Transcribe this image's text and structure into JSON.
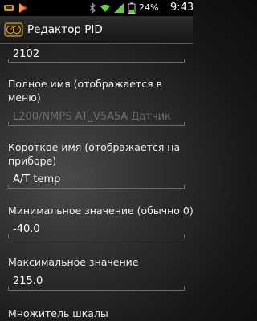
{
  "status_bar": {
    "battery_percent": "24%",
    "time": "9:43",
    "icons": [
      "notification-app-icon",
      "play-store-icon",
      "bluetooth-icon",
      "wifi-icon",
      "signal-icon",
      "battery-icon"
    ]
  },
  "title_bar": {
    "title": "Редактор PID",
    "app_icon": "car-dashboard-icon"
  },
  "fields": [
    {
      "label": "",
      "value": "2102"
    },
    {
      "label": "Полное имя (отображается в меню)",
      "value": "L200/NMPS AT_V5A5A Датчик"
    },
    {
      "label": "Короткое имя (отображается на приборе)",
      "value": "A/T temp"
    },
    {
      "label": "Минимальное значение (обычно 0)",
      "value": "-40.0"
    },
    {
      "label": "Максимальное значение",
      "value": "215.0"
    },
    {
      "label": "Множитель шкалы",
      "value": ""
    }
  ],
  "colors": {
    "status_bar_bg": "#000000",
    "signal_green": "#5fd13b",
    "text": "#ffffff",
    "disabled_text": "#6c6c6c"
  }
}
